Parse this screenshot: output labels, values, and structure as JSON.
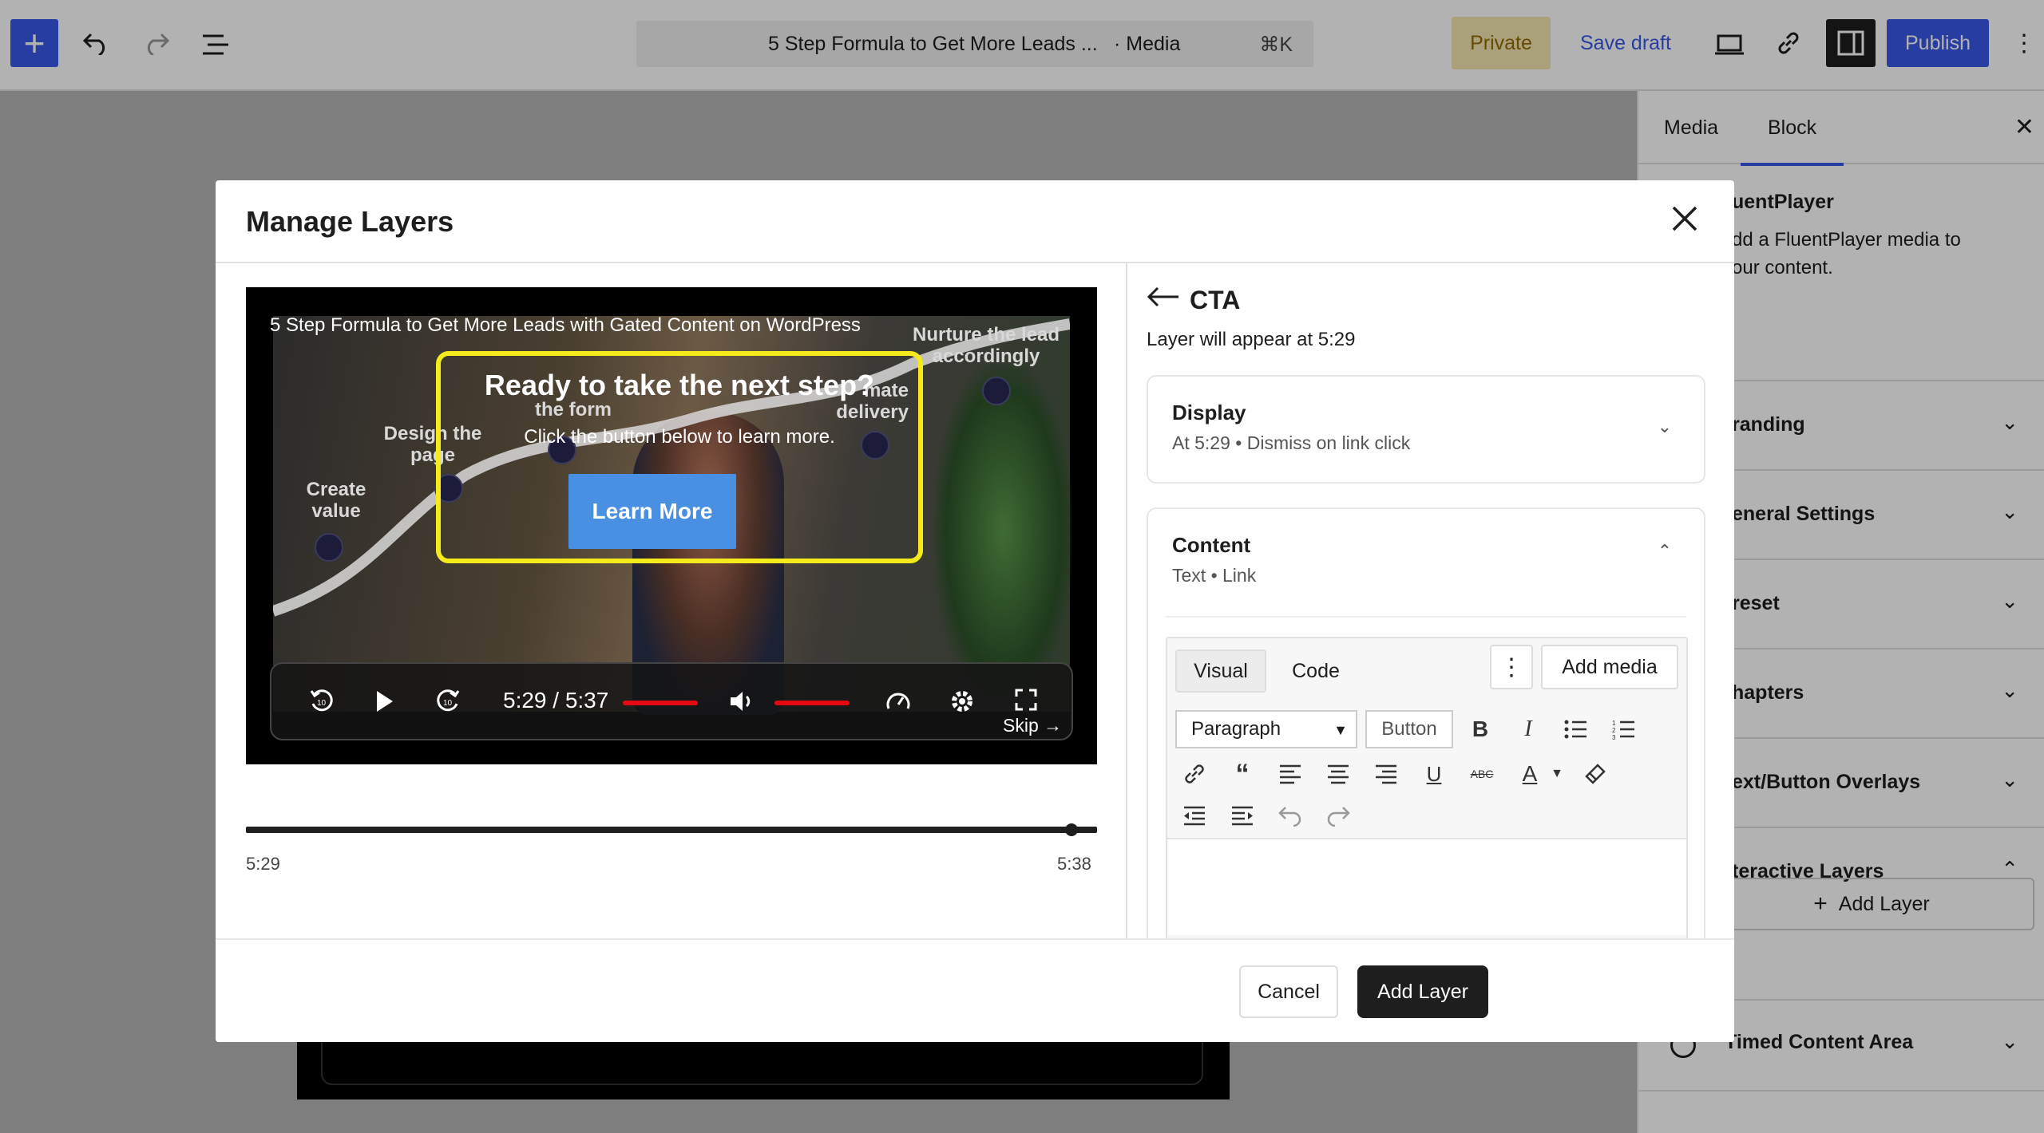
{
  "toolbar": {
    "doc_title": "5 Step Formula to Get More Leads ...",
    "doc_type": "· Media",
    "shortcut": "⌘K",
    "private_label": "Private",
    "save_draft_label": "Save draft",
    "publish_label": "Publish"
  },
  "sidebar": {
    "tabs": [
      "Media",
      "Block"
    ],
    "block_name": "uentPlayer",
    "block_desc_1": "dd a FluentPlayer media to",
    "block_desc_2": "our content.",
    "sections": [
      "randing",
      "eneral Settings",
      "reset",
      "hapters",
      "ext/Button Overlays",
      "teractive Layers"
    ],
    "add_layer": "Add Layer",
    "timed_content": "Timed Content Area"
  },
  "modal": {
    "title": "Manage Layers",
    "video": {
      "title": "5 Step Formula to Get More Leads with Gated Content on WordPress",
      "labels": {
        "nurture": "Nurture the lead accordingly",
        "automate": "mate delivery",
        "form": "the form",
        "design": "Design the page",
        "create": "Create value"
      },
      "cta_heading": "Ready to take the next step?",
      "cta_sub": "Click the button below to learn more.",
      "cta_button": "Learn More",
      "time": "5:29 / 5:37",
      "progress": 1.0,
      "volume": 1.0,
      "skip": "Skip →"
    },
    "timeline": {
      "start": "5:29",
      "end": "5:38",
      "position": 0.97
    },
    "panel": {
      "title": "CTA",
      "subtitle": "Layer will appear at 5:29",
      "display": {
        "heading": "Display",
        "summary": "At 5:29 • Dismiss on link click"
      },
      "content": {
        "heading": "Content",
        "summary": "Text • Link"
      },
      "editor": {
        "tab_visual": "Visual",
        "tab_code": "Code",
        "add_media": "Add media",
        "format": "Paragraph",
        "button_label": "Button"
      }
    },
    "footer": {
      "cancel": "Cancel",
      "add_layer": "Add Layer"
    }
  },
  "colors": {
    "accent": "#3858e9",
    "cta_border": "#f5ea1b",
    "cta_button": "#4a90e2",
    "progress": "#e50914"
  }
}
